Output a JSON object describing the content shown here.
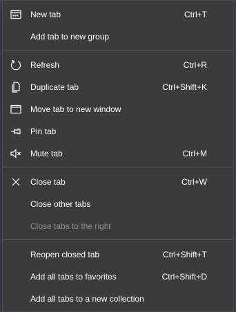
{
  "menu": {
    "items": [
      {
        "label": "New tab",
        "shortcut": "Ctrl+T",
        "icon": "new-tab-icon"
      },
      {
        "label": "Add tab to new group",
        "shortcut": "",
        "icon": ""
      },
      {
        "label": "Refresh",
        "shortcut": "Ctrl+R",
        "icon": "refresh-icon"
      },
      {
        "label": "Duplicate tab",
        "shortcut": "Ctrl+Shift+K",
        "icon": "duplicate-icon"
      },
      {
        "label": "Move tab to new window",
        "shortcut": "",
        "icon": "window-icon"
      },
      {
        "label": "Pin tab",
        "shortcut": "",
        "icon": "pin-icon"
      },
      {
        "label": "Mute tab",
        "shortcut": "Ctrl+M",
        "icon": "mute-icon"
      },
      {
        "label": "Close tab",
        "shortcut": "Ctrl+W",
        "icon": "close-icon"
      },
      {
        "label": "Close other tabs",
        "shortcut": "",
        "icon": ""
      },
      {
        "label": "Close tabs to the right",
        "shortcut": "",
        "icon": "",
        "disabled": true
      },
      {
        "label": "Reopen closed tab",
        "shortcut": "Ctrl+Shift+T",
        "icon": ""
      },
      {
        "label": "Add all tabs to favorites",
        "shortcut": "Ctrl+Shift+D",
        "icon": ""
      },
      {
        "label": "Add all tabs to a new collection",
        "shortcut": "",
        "icon": ""
      }
    ]
  },
  "colors": {
    "menu_background": "#3b3b3b",
    "text": "#ffffff",
    "disabled_text": "#8f8f8f",
    "separator": "#565656"
  }
}
